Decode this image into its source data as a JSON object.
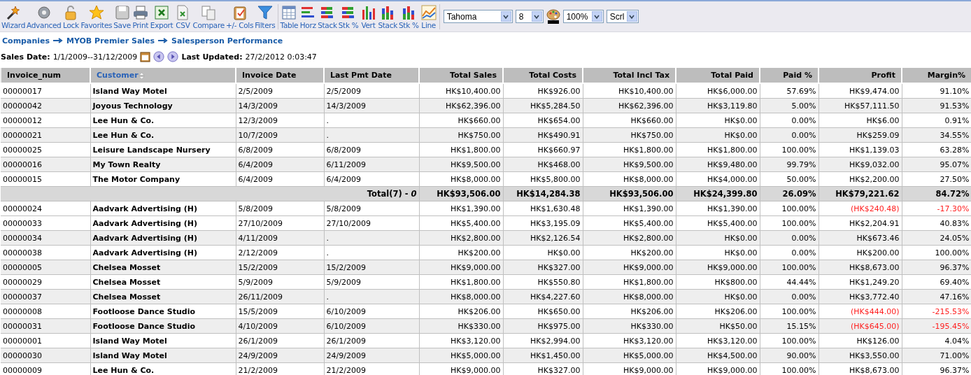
{
  "toolbar": {
    "groups": [
      [
        {
          "label": "Wizard"
        },
        {
          "label": "Advanced"
        },
        {
          "label": "Lock"
        },
        {
          "label": "Favorites"
        },
        {
          "label": "Save"
        },
        {
          "label": "Print"
        },
        {
          "label": "Export"
        },
        {
          "label": "CSV"
        },
        {
          "label": "Compare"
        },
        {
          "label": "+/- Cols"
        },
        {
          "label": "Filters"
        }
      ],
      [
        {
          "label": "Table"
        },
        {
          "label": "Horz"
        },
        {
          "label": "Stack"
        },
        {
          "label": "Stk %"
        },
        {
          "label": "Vert"
        },
        {
          "label": "Stack"
        },
        {
          "label": "Stk %"
        },
        {
          "label": "Line"
        }
      ]
    ],
    "font": "Tahoma",
    "font_size": "8",
    "zoom": "100%",
    "scroll": "Scrl"
  },
  "breadcrumb": [
    "Companies",
    "MYOB Premier Sales",
    "Salesperson Performance"
  ],
  "filter": {
    "sales_date_label": "Sales Date:",
    "sales_date": "1/1/2009--31/12/2009",
    "updated_label": "Last Updated:",
    "updated": "27/2/2012 0:03:47"
  },
  "table": {
    "columns": [
      {
        "label": "Invoice_num",
        "sorted": false
      },
      {
        "label": "Customer",
        "sorted": true
      },
      {
        "label": "Invoice Date",
        "sorted": false
      },
      {
        "label": "Last Pmt Date",
        "sorted": false
      },
      {
        "label": "Total Sales",
        "sorted": false
      },
      {
        "label": "Total Costs",
        "sorted": false
      },
      {
        "label": "Total Incl Tax",
        "sorted": false
      },
      {
        "label": "Total Paid",
        "sorted": false
      },
      {
        "label": "Paid %",
        "sorted": false
      },
      {
        "label": "Profit",
        "sorted": false
      },
      {
        "label": "Margin%",
        "sorted": false
      }
    ],
    "rows": [
      {
        "kind": "data",
        "negative": false,
        "cells": [
          "00000017",
          "Island Way Motel",
          "2/5/2009",
          "2/5/2009",
          "HK$10,400.00",
          "HK$926.00",
          "HK$10,400.00",
          "HK$6,000.00",
          "57.69%",
          "HK$9,474.00",
          "91.10%"
        ]
      },
      {
        "kind": "data",
        "negative": false,
        "cells": [
          "00000042",
          "Joyous Technology",
          "14/3/2009",
          "14/3/2009",
          "HK$62,396.00",
          "HK$5,284.50",
          "HK$62,396.00",
          "HK$3,119.80",
          "5.00%",
          "HK$57,111.50",
          "91.53%"
        ]
      },
      {
        "kind": "data",
        "negative": false,
        "cells": [
          "00000012",
          "Lee Hun & Co.",
          "12/3/2009",
          ".",
          "HK$660.00",
          "HK$654.00",
          "HK$660.00",
          "HK$0.00",
          "0.00%",
          "HK$6.00",
          "0.91%"
        ]
      },
      {
        "kind": "data",
        "negative": false,
        "cells": [
          "00000021",
          "Lee Hun & Co.",
          "10/7/2009",
          ".",
          "HK$750.00",
          "HK$490.91",
          "HK$750.00",
          "HK$0.00",
          "0.00%",
          "HK$259.09",
          "34.55%"
        ]
      },
      {
        "kind": "data",
        "negative": false,
        "cells": [
          "00000025",
          "Leisure Landscape Nursery",
          "6/8/2009",
          "6/8/2009",
          "HK$1,800.00",
          "HK$660.97",
          "HK$1,800.00",
          "HK$1,800.00",
          "100.00%",
          "HK$1,139.03",
          "63.28%"
        ]
      },
      {
        "kind": "data",
        "negative": false,
        "cells": [
          "00000016",
          "My Town Realty",
          "6/4/2009",
          "6/11/2009",
          "HK$9,500.00",
          "HK$468.00",
          "HK$9,500.00",
          "HK$9,480.00",
          "99.79%",
          "HK$9,032.00",
          "95.07%"
        ]
      },
      {
        "kind": "data",
        "negative": false,
        "cells": [
          "00000015",
          "The Motor Company",
          "6/4/2009",
          "6/4/2009",
          "HK$8,000.00",
          "HK$5,800.00",
          "HK$8,000.00",
          "HK$4,000.00",
          "50.00%",
          "HK$2,200.00",
          "27.50%"
        ]
      },
      {
        "kind": "total",
        "cells": [
          {
            "text": "Total(7) - *0*",
            "colspan": 4
          },
          "HK$93,506.00",
          "HK$14,284.38",
          "HK$93,506.00",
          "HK$24,399.80",
          "26.09%",
          "HK$79,221.62",
          "84.72%"
        ]
      },
      {
        "kind": "data",
        "negative": true,
        "cells": [
          "00000024",
          "Aadvark Advertising (H)",
          "5/8/2009",
          "5/8/2009",
          "HK$1,390.00",
          "HK$1,630.48",
          "HK$1,390.00",
          "HK$1,390.00",
          "100.00%",
          "(HK$240.48)",
          "-17.30%"
        ]
      },
      {
        "kind": "data",
        "negative": false,
        "cells": [
          "00000033",
          "Aadvark Advertising (H)",
          "27/10/2009",
          "27/10/2009",
          "HK$5,400.00",
          "HK$3,195.09",
          "HK$5,400.00",
          "HK$5,400.00",
          "100.00%",
          "HK$2,204.91",
          "40.83%"
        ]
      },
      {
        "kind": "data",
        "negative": false,
        "cells": [
          "00000034",
          "Aadvark Advertising (H)",
          "4/11/2009",
          ".",
          "HK$2,800.00",
          "HK$2,126.54",
          "HK$2,800.00",
          "HK$0.00",
          "0.00%",
          "HK$673.46",
          "24.05%"
        ]
      },
      {
        "kind": "data",
        "negative": false,
        "cells": [
          "00000038",
          "Aadvark Advertising (H)",
          "2/12/2009",
          ".",
          "HK$200.00",
          "HK$0.00",
          "HK$200.00",
          "HK$0.00",
          "0.00%",
          "HK$200.00",
          "100.00%"
        ]
      },
      {
        "kind": "data",
        "negative": false,
        "cells": [
          "00000005",
          "Chelsea Mosset",
          "15/2/2009",
          "15/2/2009",
          "HK$9,000.00",
          "HK$327.00",
          "HK$9,000.00",
          "HK$9,000.00",
          "100.00%",
          "HK$8,673.00",
          "96.37%"
        ]
      },
      {
        "kind": "data",
        "negative": false,
        "cells": [
          "00000029",
          "Chelsea Mosset",
          "5/9/2009",
          "5/9/2009",
          "HK$1,800.00",
          "HK$550.80",
          "HK$1,800.00",
          "HK$800.00",
          "44.44%",
          "HK$1,249.20",
          "69.40%"
        ]
      },
      {
        "kind": "data",
        "negative": false,
        "cells": [
          "00000037",
          "Chelsea Mosset",
          "26/11/2009",
          ".",
          "HK$8,000.00",
          "HK$4,227.60",
          "HK$8,000.00",
          "HK$0.00",
          "0.00%",
          "HK$3,772.40",
          "47.16%"
        ]
      },
      {
        "kind": "data",
        "negative": true,
        "cells": [
          "00000008",
          "Footloose Dance Studio",
          "15/5/2009",
          "6/10/2009",
          "HK$206.00",
          "HK$650.00",
          "HK$206.00",
          "HK$206.00",
          "100.00%",
          "(HK$444.00)",
          "-215.53%"
        ]
      },
      {
        "kind": "data",
        "negative": true,
        "cells": [
          "00000031",
          "Footloose Dance Studio",
          "4/10/2009",
          "6/10/2009",
          "HK$330.00",
          "HK$975.00",
          "HK$330.00",
          "HK$50.00",
          "15.15%",
          "(HK$645.00)",
          "-195.45%"
        ]
      },
      {
        "kind": "data",
        "negative": false,
        "cells": [
          "00000001",
          "Island Way Motel",
          "26/1/2009",
          "26/1/2009",
          "HK$3,120.00",
          "HK$2,994.00",
          "HK$3,120.00",
          "HK$3,120.00",
          "100.00%",
          "HK$126.00",
          "4.04%"
        ]
      },
      {
        "kind": "data",
        "negative": false,
        "cells": [
          "00000030",
          "Island Way Motel",
          "24/9/2009",
          "24/9/2009",
          "HK$5,000.00",
          "HK$1,450.00",
          "HK$5,000.00",
          "HK$4,500.00",
          "90.00%",
          "HK$3,550.00",
          "71.00%"
        ]
      },
      {
        "kind": "data",
        "negative": false,
        "cells": [
          "00000009",
          "Lee Hun & Co.",
          "21/2/2009",
          "21/2/2009",
          "HK$9,000.00",
          "HK$327.00",
          "HK$9,000.00",
          "HK$9,000.00",
          "100.00%",
          "HK$8,673.00",
          "96.37%"
        ]
      }
    ]
  }
}
